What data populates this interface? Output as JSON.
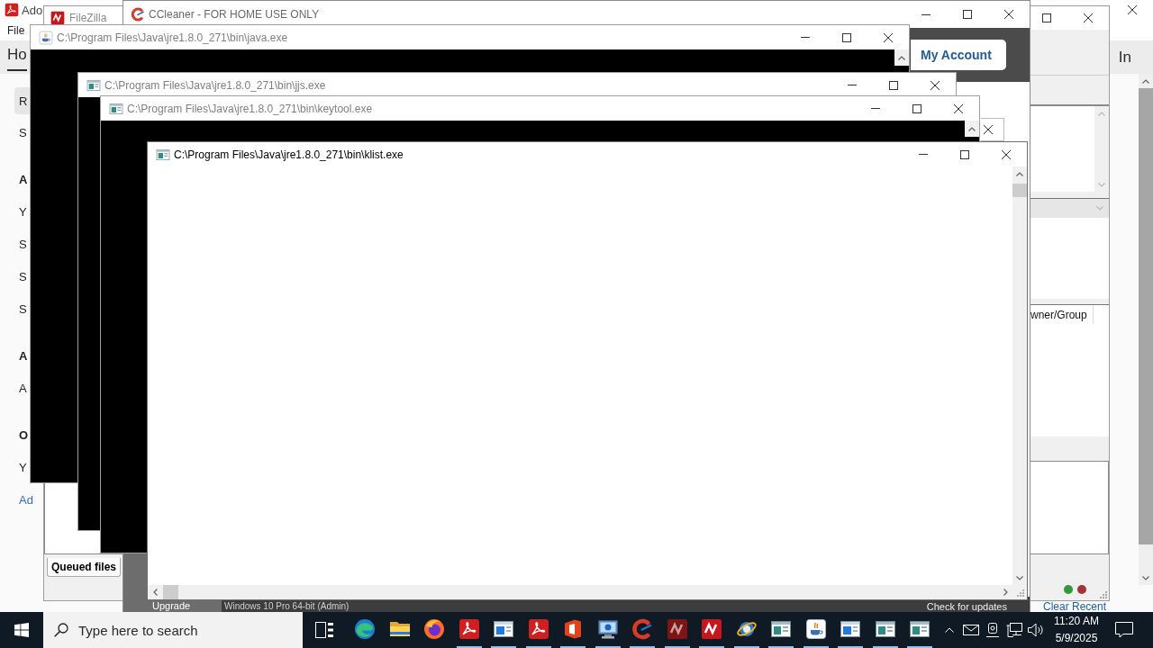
{
  "acrobat": {
    "title": "Ado",
    "menu": [
      "File"
    ],
    "tabs": [
      {
        "label": "Ho",
        "selected": true
      }
    ],
    "sign_in": "In",
    "sidebar": [
      {
        "kind": "button",
        "text": "R"
      },
      {
        "kind": "item",
        "text": "S"
      },
      {
        "kind": "heading",
        "text": "A"
      },
      {
        "kind": "item",
        "text": "Y"
      },
      {
        "kind": "item",
        "text": "S"
      },
      {
        "kind": "item",
        "text": "S"
      },
      {
        "kind": "item",
        "text": "S"
      },
      {
        "kind": "heading",
        "text": "A"
      },
      {
        "kind": "item",
        "text": "A"
      },
      {
        "kind": "heading",
        "text": "O"
      },
      {
        "kind": "item",
        "text": "Y"
      },
      {
        "kind": "link",
        "text": "Ad"
      }
    ],
    "recent_link": "Clear Recent"
  },
  "filezilla": {
    "title": "FileZilla",
    "column_header": "wner/Group",
    "queue_tabs": [
      {
        "label": "Queued files",
        "selected": true
      }
    ],
    "status_lights": [
      {
        "color": "#2e9a3a"
      },
      {
        "color": "#a8323a"
      }
    ]
  },
  "ccleaner": {
    "title": "CCleaner - FOR HOME USE ONLY",
    "account_button": "My Account",
    "nav_item": "Upgrade",
    "system_info": "Windows 10 Pro 64-bit (Admin)",
    "update_link": "Check for updates"
  },
  "console_windows": [
    {
      "title": "C:\\Program Files\\Java\\jre1.8.0_271\\bin\\java.exe",
      "kind": "java",
      "dark": true,
      "active": false
    },
    {
      "title": "C:\\Program Files\\Java\\jre1.8.0_271\\bin\\jjs.exe",
      "kind": "console",
      "dark": true,
      "active": false
    },
    {
      "title": "C:\\Program Files\\Java\\jre1.8.0_271\\bin\\keytool.exe",
      "kind": "console",
      "dark": true,
      "active": false
    },
    {
      "title": "C:\\Program Files\\Java\\jre1.8.0_271\\bin\\klist.exe",
      "kind": "console",
      "dark": false,
      "active": true
    }
  ],
  "taskbar": {
    "search": {
      "placeholder": "Type here to search"
    },
    "apps": [
      {
        "kind": "edge",
        "running": false
      },
      {
        "kind": "folder",
        "running": false
      },
      {
        "kind": "firefox",
        "running": false
      },
      {
        "kind": "pdf",
        "running": true
      },
      {
        "kind": "window",
        "running": true
      },
      {
        "kind": "pdf",
        "running": true
      },
      {
        "kind": "office",
        "running": true
      },
      {
        "kind": "monitor",
        "running": true
      },
      {
        "kind": "ccleaner",
        "running": true
      },
      {
        "kind": "filezilla-old",
        "running": true
      },
      {
        "kind": "filezilla",
        "running": true
      },
      {
        "kind": "ie",
        "running": true
      },
      {
        "kind": "console",
        "running": true
      },
      {
        "kind": "java",
        "running": true
      },
      {
        "kind": "window",
        "running": true
      },
      {
        "kind": "console",
        "running": true
      },
      {
        "kind": "console",
        "running": true
      }
    ],
    "time": "11:20 AM",
    "date": "5/9/2025"
  }
}
